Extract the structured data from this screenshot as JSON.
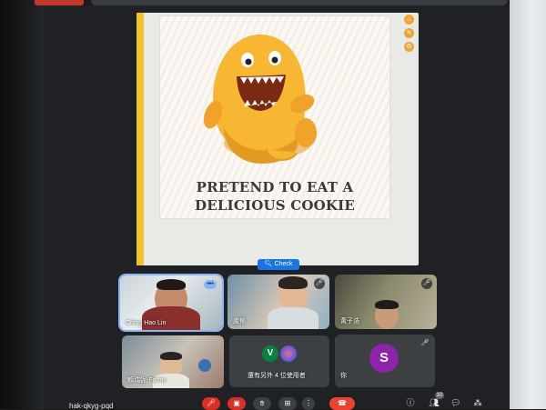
{
  "slide": {
    "text_line1": "PRETEND TO EAT A",
    "text_line2": "DELICIOUS COOKIE",
    "check_label": "Check",
    "tool_icons": [
      "home-icon",
      "edit-icon",
      "settings-icon"
    ]
  },
  "participants": [
    {
      "name": "Ching Hao Lin",
      "mic_muted": false,
      "has_video": true
    },
    {
      "name": "盧郁",
      "mic_muted": true,
      "has_video": true
    },
    {
      "name": "黃子浩",
      "mic_muted": false,
      "has_video": true
    },
    {
      "name": "賴瑞妮-Fanny",
      "mic_muted": false,
      "has_video": true
    },
    {
      "name": "還有另外 4 位使用者",
      "avatar_letter": "V",
      "has_video": false
    },
    {
      "name": "你",
      "avatar_letter": "S",
      "mic_muted": true,
      "has_video": false
    }
  ],
  "toolbar": {
    "meeting_code": "hak-qkyg-pqd",
    "participants_count": "10"
  },
  "colors": {
    "accent": "#8ab4f8",
    "end_call": "#ea4335",
    "avatar_v": "#0b8043",
    "avatar_s": "#8e24aa",
    "check_button": "#1a73e8"
  }
}
